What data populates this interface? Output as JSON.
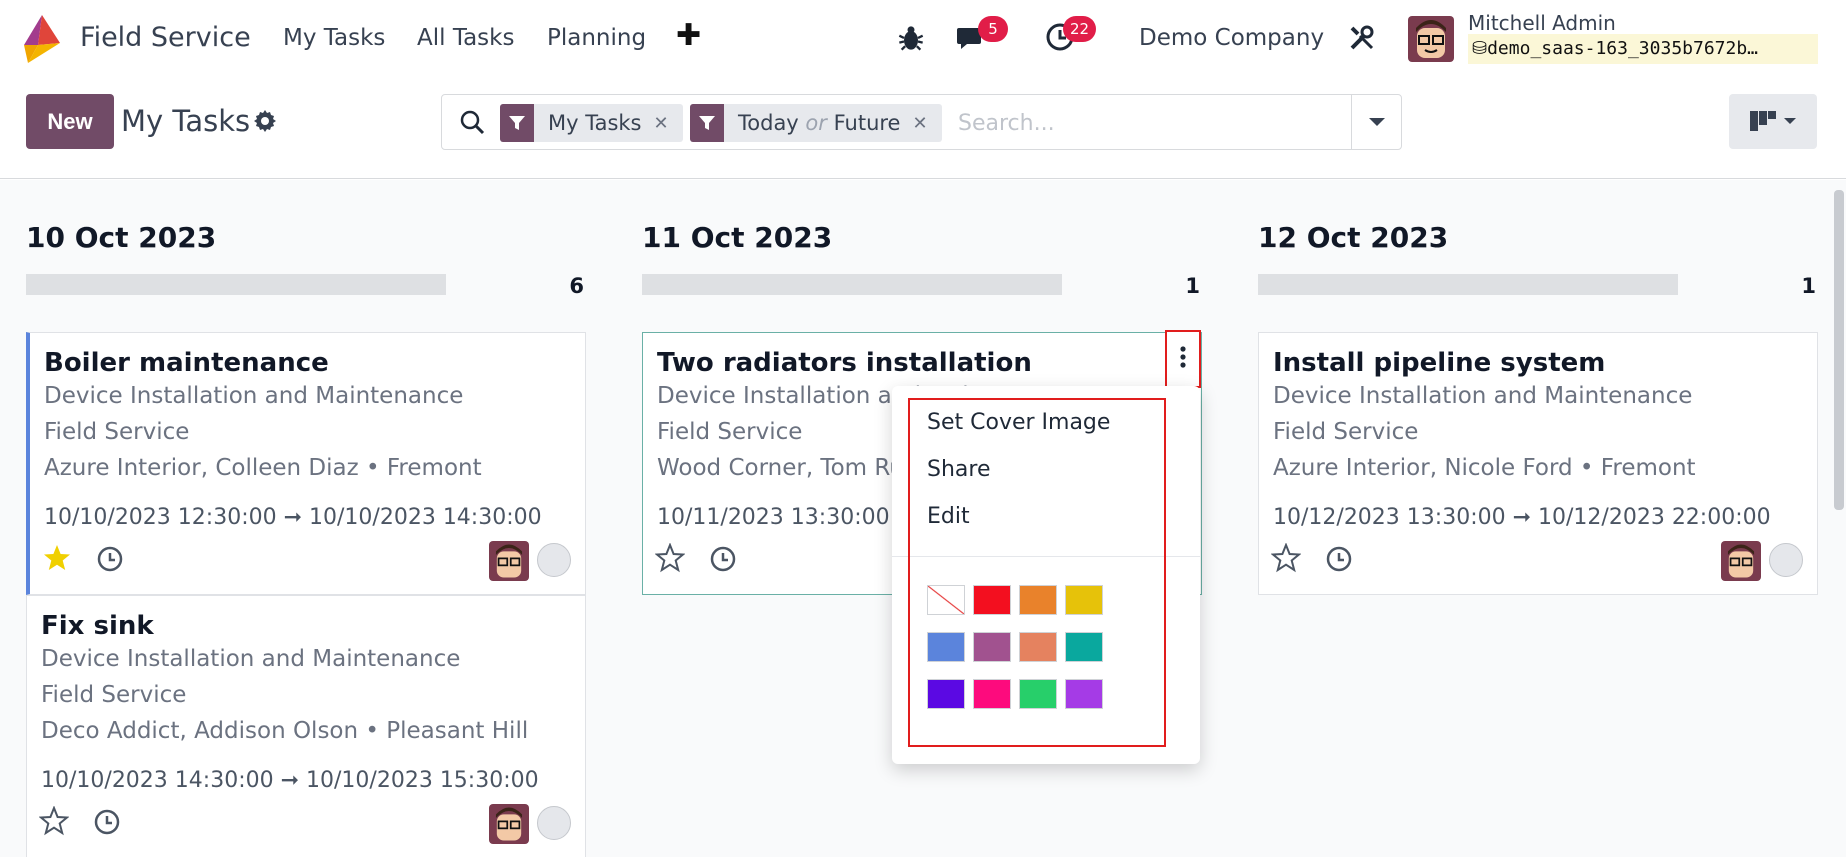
{
  "navbar": {
    "app_name": "Field Service",
    "menu": [
      "My Tasks",
      "All Tasks",
      "Planning"
    ],
    "add_icon": "plus-icon",
    "messages_count": "5",
    "activities_count": "22",
    "company": "Demo Company",
    "user_name": "Mitchell Admin",
    "database": "demo_saas-163_3035b7672b…"
  },
  "control_panel": {
    "new_label": "New",
    "title": "My Tasks",
    "facets": [
      {
        "label": "My Tasks"
      },
      {
        "label_a": "Today",
        "or": "or",
        "label_b": "Future"
      }
    ],
    "search_placeholder": "Search..."
  },
  "columns": [
    {
      "date": "10 Oct 2023",
      "count": "6",
      "cards": [
        {
          "title": "Boiler maintenance",
          "project": "Device Installation and Maintenance",
          "category": "Field Service",
          "customer": "Azure Interior, Colleen Diaz • Fremont",
          "dates": "10/10/2023 12:30:00  ➞  10/10/2023 14:30:00",
          "starred": true
        },
        {
          "title": "Fix sink",
          "project": "Device Installation and Maintenance",
          "category": "Field Service",
          "customer": "Deco Addict, Addison Olson • Pleasant Hill",
          "dates": "10/10/2023 14:30:00  ➞  10/10/2023 15:30:00",
          "starred": false
        }
      ]
    },
    {
      "date": "11 Oct 2023",
      "count": "1",
      "cards": [
        {
          "title": "Two radiators installation",
          "project": "Device Installation and Maint",
          "category": "Field Service",
          "customer": "Wood Corner, Tom Ru",
          "dates": "10/11/2023 13:30:00",
          "starred": false
        }
      ]
    },
    {
      "date": "12 Oct 2023",
      "count": "1",
      "cards": [
        {
          "title": "Install pipeline system",
          "project": "Device Installation and Maintenance",
          "category": "Field Service",
          "customer": "Azure Interior, Nicole Ford • Fremont",
          "dates": "10/12/2023 13:30:00  ➞  10/12/2023 22:00:00",
          "starred": false
        }
      ]
    }
  ],
  "dropdown": {
    "items": [
      "Set Cover Image",
      "Share",
      "Edit"
    ],
    "colors": [
      "none",
      "#f30f1f",
      "#e9822b",
      "#e6c20a",
      "#5b84dc",
      "#a1528f",
      "#e5825f",
      "#0aa89e",
      "#5b09e3",
      "#fd0b7d",
      "#27cf6a",
      "#a53be6"
    ]
  },
  "theme": {
    "brand": "#714b67",
    "badge": "#e11d48",
    "highlight": "#e11d1d",
    "star": "#f0d000"
  }
}
